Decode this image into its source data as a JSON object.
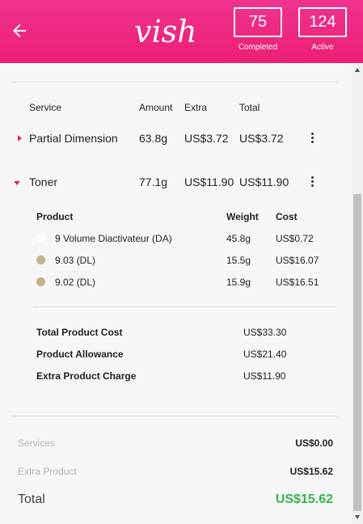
{
  "header": {
    "logo_text": "vish",
    "completed": {
      "value": "75",
      "label": "Completed"
    },
    "active": {
      "value": "124",
      "label": "Active"
    }
  },
  "services_table": {
    "columns": {
      "service": "Service",
      "amount": "Amount",
      "extra": "Extra",
      "total": "Total"
    },
    "rows": [
      {
        "name": "Partial Dimension",
        "amount": "63.8g",
        "extra": "US$3.72",
        "total": "US$3.72",
        "expanded": false
      },
      {
        "name": "Toner",
        "amount": "77.1g",
        "extra": "US$11.90",
        "total": "US$11.90",
        "expanded": true
      }
    ]
  },
  "products_table": {
    "columns": {
      "product": "Product",
      "weight": "Weight",
      "cost": "Cost"
    },
    "rows": [
      {
        "name": "9 Volume Diactivateur (DA)",
        "weight": "45.8g",
        "cost": "US$0.72",
        "swatch": "#ffffff"
      },
      {
        "name": "9.03 (DL)",
        "weight": "15.5g",
        "cost": "US$16.07",
        "swatch": "#c7b08e"
      },
      {
        "name": "9.02 (DL)",
        "weight": "15.9g",
        "cost": "US$16.51",
        "swatch": "#c7b08e"
      }
    ],
    "totals": [
      {
        "label": "Total Product Cost",
        "value": "US$33.30"
      },
      {
        "label": "Product Allowance",
        "value": "US$21.40"
      },
      {
        "label": "Extra Product Charge",
        "value": "US$11.90"
      }
    ]
  },
  "summary": {
    "services_label": "Services",
    "services_value": "US$0.00",
    "extra_label": "Extra Product",
    "extra_value": "US$15.62",
    "total_label": "Total",
    "total_value": "US$15.62"
  },
  "colors": {
    "brand_pink": "#ec1f74",
    "accent_arrow": "#e91e78",
    "total_green": "#37b24d"
  }
}
